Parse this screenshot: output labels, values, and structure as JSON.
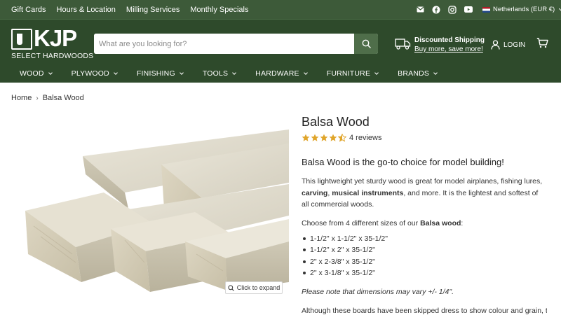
{
  "topbar": {
    "links": [
      "Gift Cards",
      "Hours & Location",
      "Milling Services",
      "Monthly Specials"
    ],
    "social_icons": [
      "email-icon",
      "facebook-icon",
      "instagram-icon",
      "youtube-icon"
    ],
    "locale": "Netherlands (EUR €)"
  },
  "header": {
    "logo_letters": "KJP",
    "logo_sub": "SELECT HARDWOODS",
    "search_placeholder": "What are you looking for?",
    "shipping_title": "Discounted Shipping",
    "shipping_link": "Buy more, save more!",
    "login_label": "LOGIN"
  },
  "nav": {
    "items": [
      "WOOD",
      "PLYWOOD",
      "FINISHING",
      "TOOLS",
      "HARDWARE",
      "FURNITURE",
      "BRANDS"
    ]
  },
  "breadcrumb": {
    "home": "Home",
    "current": "Balsa Wood"
  },
  "gallery": {
    "expand_label": "Click to expand"
  },
  "product": {
    "title": "Balsa Wood",
    "rating": 4.5,
    "reviews": "4 reviews",
    "headline": "Balsa Wood is the go-to choice for model building!",
    "desc_part1": "This lightweight yet sturdy wood is great for model airplanes, fishing lures, ",
    "desc_bold1": "carving",
    "desc_part2": ", ",
    "desc_bold2": "musical instruments",
    "desc_part3": ", and more. It is the lightest and softest of all commercial woods.",
    "sizes_intro": "Choose from 4 different sizes of our ",
    "sizes_intro_bold": "Balsa wood",
    "sizes_intro_end": ":",
    "sizes": [
      "1-1/2\" x 1-1/2\" x 35-1/2\"",
      "1-1/2\" x 2\" x 35-1/2\"",
      "2\" x 2-3/8\" x 35-1/2\"",
      "2\" x 3-1/8\" x 35-1/2\""
    ],
    "note": "Please note that dimensions may vary +/- 1/4\".",
    "tail": "Although these boards have been skipped dress to show colour and grain, they"
  },
  "colors": {
    "topbar": "#3d5a39",
    "header": "#2e4a2b",
    "star": "#e0a52a"
  }
}
